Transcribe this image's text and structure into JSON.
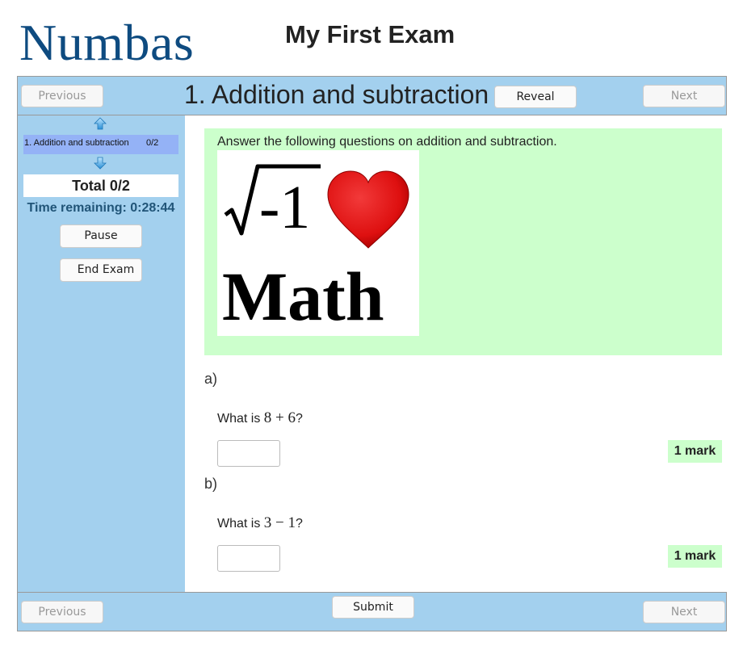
{
  "header": {
    "logo": "Numbas",
    "exam_title": "My First Exam"
  },
  "top_bar": {
    "previous_label": "Previous",
    "question_title": "1. Addition and subtraction",
    "reveal_label": "Reveal",
    "next_label": "Next"
  },
  "sidebar": {
    "up_icon": "arrow-up-icon",
    "questions": [
      {
        "label": "1. Addition and subtraction",
        "score": "0/2"
      }
    ],
    "down_icon": "arrow-down-icon",
    "total": "Total 0/2",
    "timer": "Time remaining: 0:28:44",
    "pause_label": "Pause",
    "end_exam_label": "End Exam"
  },
  "statement": {
    "text": "Answer the following questions on addition and subtraction.",
    "image": {
      "line1": "√-1",
      "heart": "heart",
      "line2": "Math"
    }
  },
  "parts": [
    {
      "label": "a)",
      "prompt_prefix": "What is ",
      "math": "8 + 6",
      "prompt_suffix": "?",
      "answer": "",
      "marks": "1 mark"
    },
    {
      "label": "b)",
      "prompt_prefix": "What is ",
      "math": "3 − 1",
      "prompt_suffix": "?",
      "answer": "",
      "marks": "1 mark"
    }
  ],
  "bottom_bar": {
    "previous_label": "Previous",
    "submit_label": "Submit",
    "next_label": "Next"
  },
  "colors": {
    "brand": "#0e4b80",
    "bar_bg": "#a3d0ee",
    "statement_bg": "#ccffcc",
    "nav_active": "#94b2f6",
    "timer": "#215578"
  }
}
